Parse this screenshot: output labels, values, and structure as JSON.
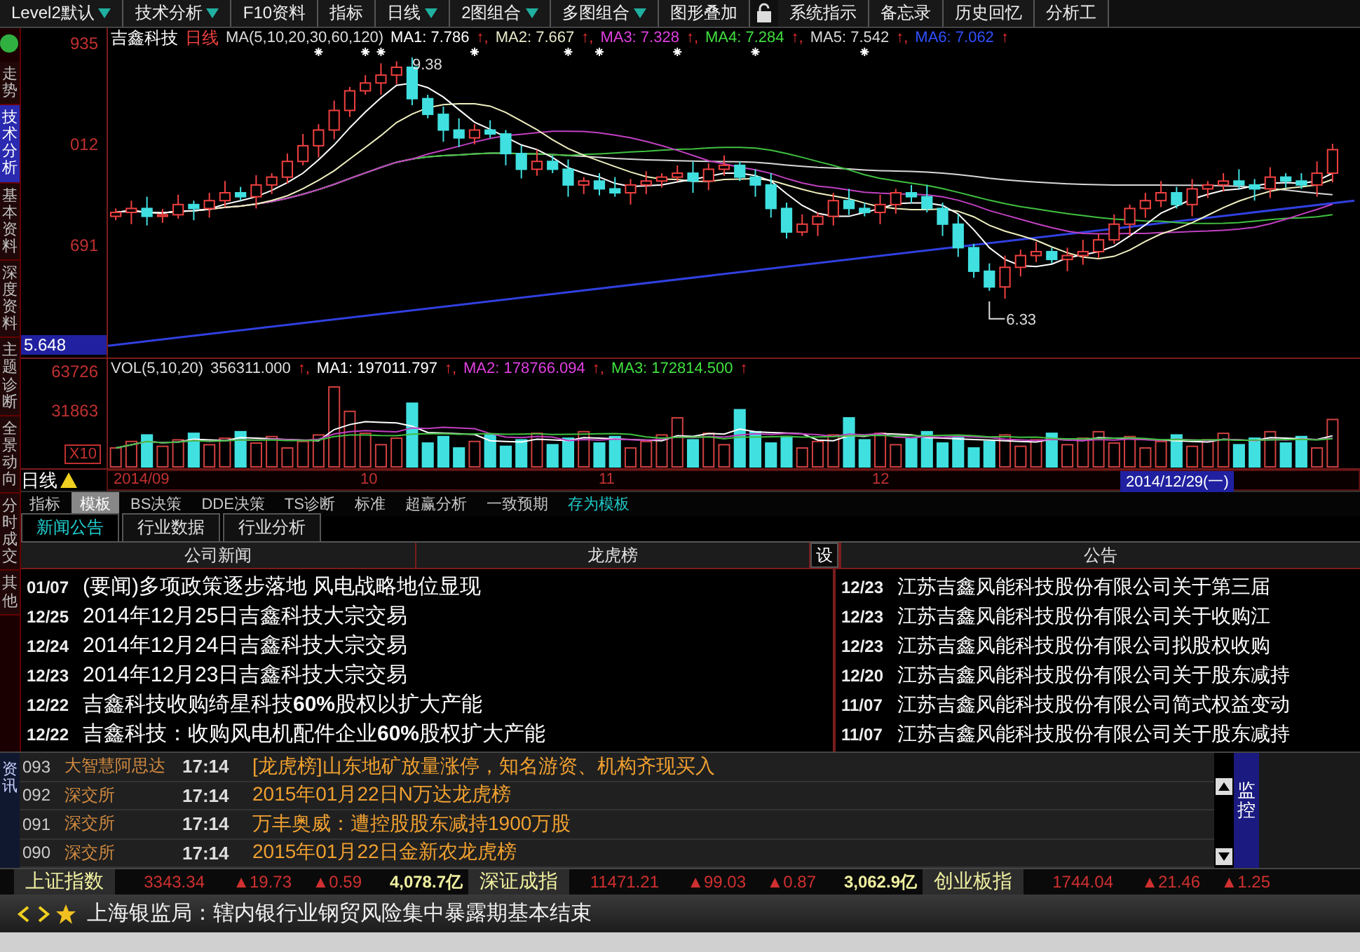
{
  "menu": [
    {
      "label": "Level2默认",
      "kind": "dropdown"
    },
    {
      "label": "技术分析",
      "kind": "dropdown"
    },
    {
      "label": "F10资料",
      "kind": "plain"
    },
    {
      "label": "指标",
      "kind": "plain"
    },
    {
      "label": "日线",
      "kind": "dropdown"
    },
    {
      "label": "2图组合",
      "kind": "dropdown"
    },
    {
      "label": "多图组合",
      "kind": "dropdown"
    },
    {
      "label": "图形叠加",
      "kind": "plain"
    },
    {
      "kind": "lock"
    },
    {
      "label": "系统指示",
      "kind": "plain"
    },
    {
      "label": "备忘录",
      "kind": "plain"
    },
    {
      "label": "历史回忆",
      "kind": "plain"
    },
    {
      "label": "分析工",
      "kind": "plain"
    }
  ],
  "side_tabs": [
    {
      "label": "走势",
      "selected": false
    },
    {
      "label": "技术分析",
      "selected": true
    },
    {
      "label": "基本资料",
      "selected": false
    },
    {
      "label": "深度资料",
      "selected": false
    },
    {
      "label": "主题诊断",
      "selected": false
    },
    {
      "label": "全景动向",
      "selected": false
    },
    {
      "label": "分时成交",
      "selected": false
    },
    {
      "label": "其他",
      "selected": false
    }
  ],
  "chart": {
    "stock": "吉鑫科技",
    "period": "日线",
    "ma_params": "MA(5,10,20,30,60,120)",
    "ma": [
      {
        "name": "MA1:",
        "value": "7.786",
        "arrow": "↑,",
        "color": "#ffffff"
      },
      {
        "name": "MA2:",
        "value": "7.667",
        "arrow": "↑,",
        "color": "#e8e8c8"
      },
      {
        "name": "MA3:",
        "value": "7.328",
        "arrow": "↑,",
        "color": "#e040e0"
      },
      {
        "name": "MA4:",
        "value": "7.284",
        "arrow": "↑,",
        "color": "#40e040"
      },
      {
        "name": "MA5:",
        "value": "7.542",
        "arrow": "↑,",
        "color": "#d8d8d8"
      },
      {
        "name": "MA6:",
        "value": "7.062",
        "arrow": "↑",
        "color": "#3050ff"
      }
    ],
    "y_labels": [
      "935",
      "012",
      "691"
    ],
    "current_price": "5.648",
    "high_mark": "9.38",
    "low_mark": "6.33"
  },
  "volume": {
    "params": "VOL(5,10,20)",
    "value": "356311.000",
    "arrow": "↑,",
    "ma": [
      {
        "name": "MA1:",
        "value": "197011.797",
        "arrow": "↑,",
        "color": "#ffffff"
      },
      {
        "name": "MA2:",
        "value": "178766.094",
        "arrow": "↑,",
        "color": "#e040e0"
      },
      {
        "name": "MA3:",
        "value": "172814.500",
        "arrow": "↑",
        "color": "#40e040"
      }
    ],
    "y_labels": [
      "63726",
      "31863"
    ],
    "unit": "X10"
  },
  "x_axis": {
    "period_label": "日线",
    "labels": [
      "2014/09",
      "10",
      "11",
      "12"
    ],
    "cursor_date": "2014/12/29(一)"
  },
  "indicator_tabs": [
    {
      "label": "指标",
      "kind": "tab",
      "selected": false
    },
    {
      "label": "模板",
      "kind": "tab",
      "selected": true
    },
    {
      "label": "BS决策",
      "kind": "tab",
      "selected": false
    },
    {
      "label": "DDE决策",
      "kind": "tab",
      "selected": false
    },
    {
      "label": "TS诊断",
      "kind": "tab",
      "selected": false
    },
    {
      "label": "标准",
      "kind": "tab",
      "selected": false
    },
    {
      "label": "超赢分析",
      "kind": "tab",
      "selected": false
    },
    {
      "label": "一致预期",
      "kind": "tab",
      "selected": false
    },
    {
      "label": "存为模板",
      "kind": "action",
      "selected": false
    }
  ],
  "info_tabs": [
    {
      "label": "新闻公告",
      "selected": true
    },
    {
      "label": "行业数据",
      "selected": false
    },
    {
      "label": "行业分析",
      "selected": false
    }
  ],
  "news_panel": {
    "columns": [
      "公司新闻",
      "龙虎榜"
    ],
    "settings_label": "设",
    "announcement_header": "公告",
    "company_news": [
      {
        "date": "01/07",
        "text": "(要闻)多项政策逐步落地 风电战略地位显现"
      },
      {
        "date": "12/25",
        "text": "2014年12月25日吉鑫科技大宗交易"
      },
      {
        "date": "12/24",
        "text": "2014年12月24日吉鑫科技大宗交易"
      },
      {
        "date": "12/23",
        "text": "2014年12月23日吉鑫科技大宗交易"
      },
      {
        "date": "12/22",
        "text": "吉鑫科技收购绮星科技**60%**股权以扩大产能"
      },
      {
        "date": "12/22",
        "text": "吉鑫科技：收购风电机配件企业**60%**股权扩大产能"
      }
    ],
    "announcements": [
      {
        "date": "12/23",
        "text": "江苏吉鑫风能科技股份有限公司关于第三届"
      },
      {
        "date": "12/23",
        "text": "江苏吉鑫风能科技股份有限公司关于收购江"
      },
      {
        "date": "12/23",
        "text": "江苏吉鑫风能科技股份有限公司拟股权收购"
      },
      {
        "date": "12/20",
        "text": "江苏吉鑫风能科技股份有限公司关于股东减持"
      },
      {
        "date": "11/07",
        "text": "江苏吉鑫风能科技股份有限公司简式权益变动"
      },
      {
        "date": "11/07",
        "text": "江苏吉鑫风能科技股份有限公司关于股东减持"
      }
    ]
  },
  "ticker": {
    "side_label": "资讯",
    "monitor_label": "监控",
    "rows": [
      {
        "id": "093",
        "source": "大智慧阿思达",
        "time": "17:14",
        "text": "[龙虎榜]山东地矿放量涨停，知名游资、机构齐现买入"
      },
      {
        "id": "092",
        "source": "深交所",
        "time": "17:14",
        "text": "2015年01月22日N万达龙虎榜"
      },
      {
        "id": "091",
        "source": "深交所",
        "time": "17:14",
        "text": "万丰奥威：遭控股股东减持1900万股"
      },
      {
        "id": "090",
        "source": "深交所",
        "time": "17:14",
        "text": "2015年01月22日金新农龙虎榜"
      }
    ]
  },
  "indices": [
    {
      "name": "上证指数",
      "value": "3343.34",
      "change": "▲19.73",
      "percent": "▲0.59",
      "turnover": "4,078.7亿"
    },
    {
      "name": "深证成指",
      "value": "11471.21",
      "change": "▲99.03",
      "percent": "▲0.87",
      "turnover": "3,062.9亿"
    },
    {
      "name": "创业板指",
      "value": "1744.04",
      "change": "▲21.46",
      "percent": "▲1.25"
    }
  ],
  "headline": {
    "text": "上海银监局：辖内银行业钢贸风险集中暴露期基本结束"
  }
}
